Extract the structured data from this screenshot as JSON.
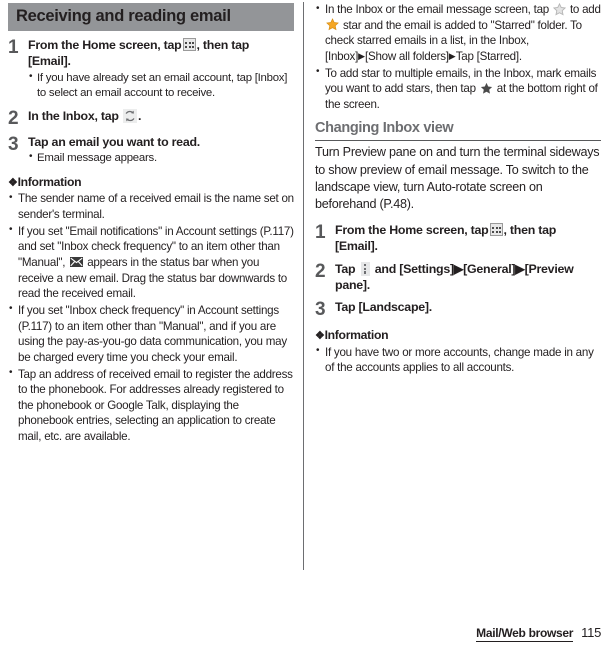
{
  "page": {
    "number": "115",
    "chapter": "Mail/Web browser"
  },
  "left_column": {
    "section_title": "Receiving and reading email",
    "steps": [
      {
        "num": "1",
        "title_before_icon": "From the Home screen, tap",
        "icon": "app-drawer-icon",
        "title_after_icon": ", then tap [Email].",
        "bullets": [
          "If you have already set an email account, tap [Inbox] to select an email account to receive."
        ]
      },
      {
        "num": "2",
        "title_before_icon": "In the Inbox, tap",
        "icon": "refresh-icon",
        "title_after_icon": ".",
        "bullets": []
      },
      {
        "num": "3",
        "title_before_icon": "Tap an email you want to read.",
        "icon": "",
        "title_after_icon": "",
        "bullets": [
          "Email message appears."
        ]
      }
    ],
    "information_heading": "Information",
    "information_bullets": [
      {
        "text_1": "The sender name of a received email is the name set on sender's terminal.",
        "icon": "",
        "text_2": ""
      },
      {
        "text_1": "If you set \"Email notifications\" in Account settings (P.117) and set \"Inbox check frequency\" to an item other than \"Manual\",",
        "icon": "envelope-icon",
        "text_2": "appears in the status bar when you receive a new email. Drag the status bar downwards to read the received email."
      },
      {
        "text_1": "If you set \"Inbox check frequency\" in Account settings (P.117) to an item other than \"Manual\", and if you are using the pay-as-you-go data communication, you may be charged every time you check your email.",
        "icon": "",
        "text_2": ""
      },
      {
        "text_1": "Tap an address of received email to register the address to the phonebook. For addresses already registered to the phonebook or Google Talk, displaying the phonebook entries, selecting an application to create mail, etc. are available.",
        "icon": "",
        "text_2": ""
      }
    ]
  },
  "right_column": {
    "top_bullets": [
      {
        "part_1": "In the Inbox or the email message screen, tap",
        "icon_1": "star-outline-icon",
        "part_2": "to add",
        "icon_2": "star-gold-icon",
        "part_3": "star and the email is added to \"Starred\" folder. To check starred emails in a list, in the Inbox, [Inbox]",
        "arrow_1": "▶",
        "part_4": "[Show all folders]",
        "arrow_2": "▶",
        "part_5": "Tap [Starred]."
      },
      {
        "part_1": "To add star to multiple emails, in the Inbox, mark emails you want to add stars, then tap",
        "icon_1": "star-solid-icon",
        "part_2": "at the bottom right of the screen.",
        "icon_2": "",
        "part_3": "",
        "arrow_1": "",
        "part_4": "",
        "arrow_2": "",
        "part_5": ""
      }
    ],
    "sub_heading": "Changing Inbox view",
    "intro_paragraph": "Turn Preview pane on and turn the terminal sideways to show preview of email message. To switch to the landscape view, turn Auto-rotate screen on beforehand (P.48).",
    "steps": [
      {
        "num": "1",
        "title_before_icon": "From the Home screen, tap",
        "icon": "app-drawer-icon",
        "title_after_icon": ", then tap [Email].",
        "bullets": []
      },
      {
        "num": "2",
        "title_before_icon": "Tap",
        "icon": "menu-icon",
        "title_after_icon": "and [Settings]▶[General]▶[Preview pane].",
        "bullets": []
      },
      {
        "num": "3",
        "title_before_icon": "Tap [Landscape].",
        "icon": "",
        "title_after_icon": "",
        "bullets": []
      }
    ],
    "information_heading": "Information",
    "information_bullets": [
      {
        "text_1": "If you have two or more accounts, change made in any of the accounts applies to all accounts.",
        "icon": "",
        "text_2": ""
      }
    ]
  },
  "colors": {
    "section_bar_bg": "#939598",
    "step_number": "#58595b",
    "sub_heading": "#6d6e71",
    "star_gold": "#f5a623",
    "star_outline": "#b5b5b5",
    "star_solid": "#4a4a4a"
  }
}
